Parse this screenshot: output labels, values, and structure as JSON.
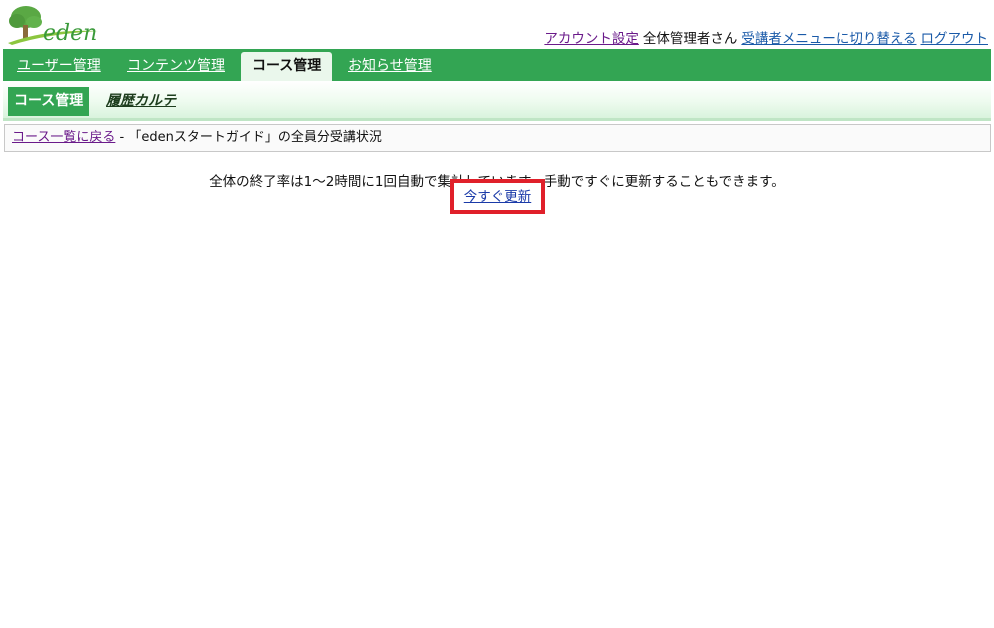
{
  "header": {
    "logo_text": "eden",
    "account_settings": "アカウント設定",
    "user_name": "全体管理者さん",
    "switch_menu": "受講者メニューに切り替える",
    "logout": "ログアウト"
  },
  "main_nav": {
    "tabs": [
      {
        "label": "ユーザー管理",
        "active": false
      },
      {
        "label": "コンテンツ管理",
        "active": false
      },
      {
        "label": "コース管理",
        "active": true
      },
      {
        "label": "お知らせ管理",
        "active": false
      }
    ]
  },
  "sub_nav": {
    "tabs": [
      {
        "label": "コース管理",
        "active": true
      },
      {
        "label": "履歴カルテ",
        "active": false
      }
    ]
  },
  "breadcrumb": {
    "back_link": "コース一覧に戻る",
    "separator": " - ",
    "current": "「edenスタートガイド」の全員分受講状況"
  },
  "main": {
    "message": "全体の終了率は1～2時間に1回自動で集計しています。手動ですぐに更新することもできます。",
    "refresh_link": "今すぐ更新"
  },
  "colors": {
    "nav_green": "#33a553",
    "highlight_red": "#e0202a",
    "link_blue": "#1a5aa8",
    "visited_purple": "#6a1a8a"
  }
}
